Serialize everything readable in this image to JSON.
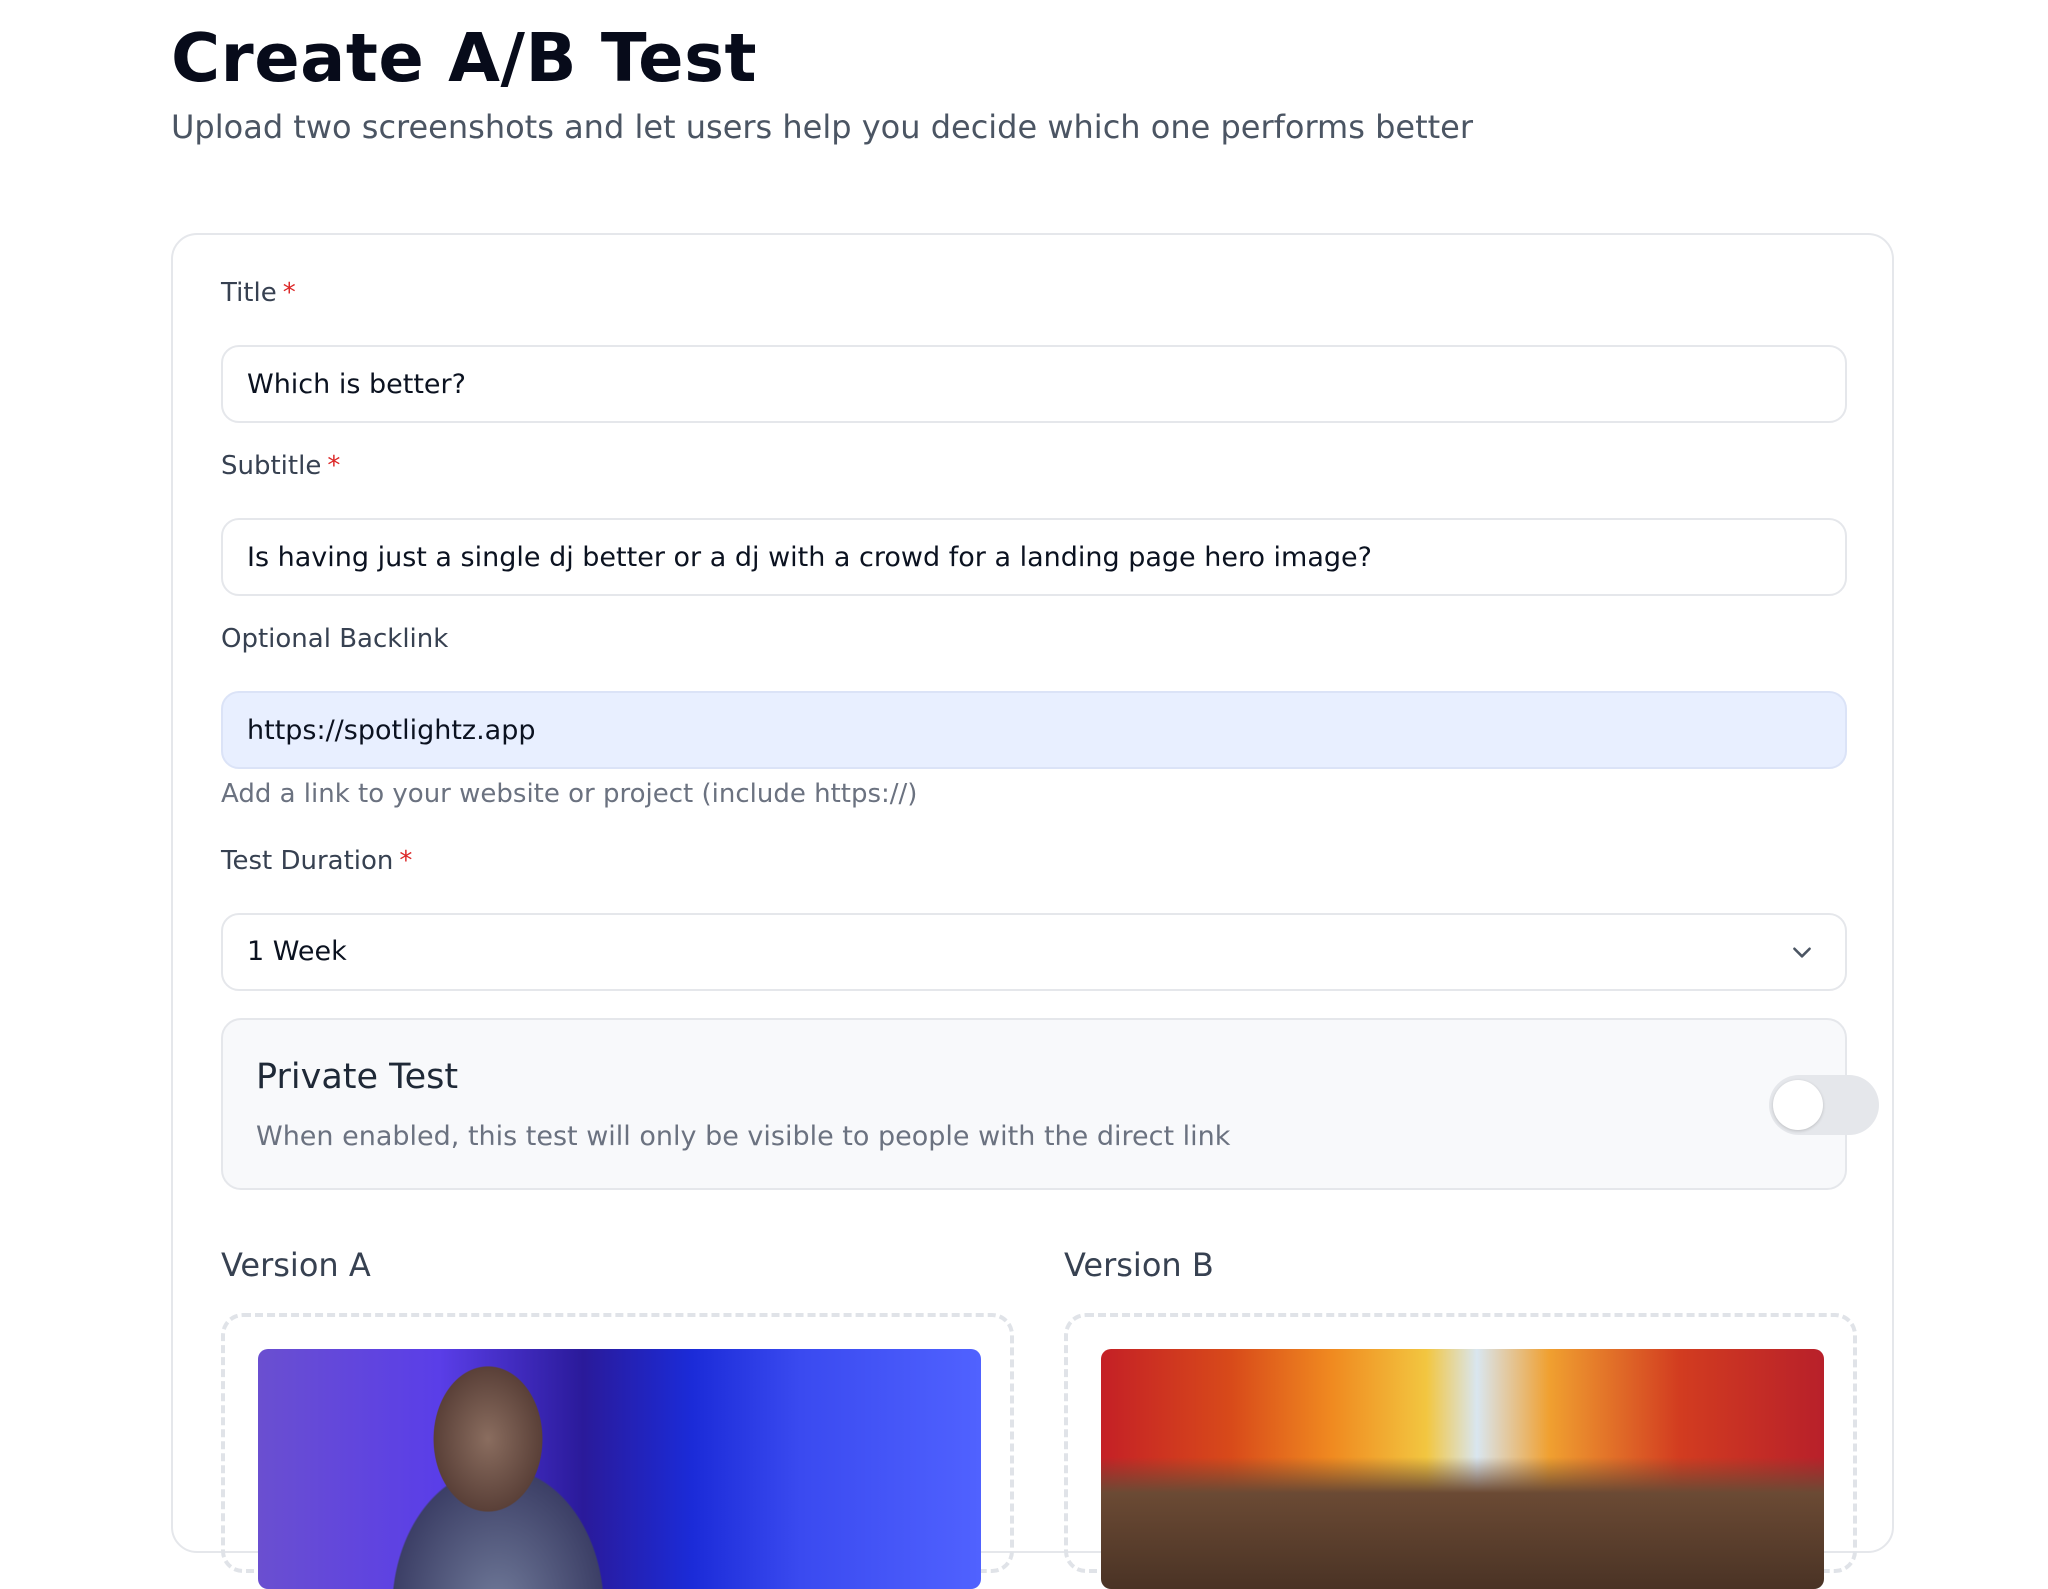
{
  "header": {
    "title": "Create A/B Test",
    "subtitle": "Upload two screenshots and let users help you decide which one performs better"
  },
  "form": {
    "title_field": {
      "label": "Title",
      "required_mark": "*",
      "value": "Which is better?"
    },
    "subtitle_field": {
      "label": "Subtitle",
      "required_mark": "*",
      "value": "Is having just a single dj better or a dj with a crowd for a landing page hero image?"
    },
    "backlink_field": {
      "label": "Optional Backlink",
      "value": "https://spotlightz.app",
      "help": "Add a link to your website or project (include https://)"
    },
    "duration_field": {
      "label": "Test Duration",
      "required_mark": "*",
      "selected": "1 Week"
    },
    "private_test": {
      "title": "Private Test",
      "description": "When enabled, this test will only be visible to people with the direct link",
      "enabled": false
    },
    "versions": [
      {
        "label": "Version A"
      },
      {
        "label": "Version B"
      }
    ]
  },
  "colors": {
    "required": "#dc2626",
    "autofill_bg": "#e8efff",
    "toggle_off": "#e5e7eb",
    "title_text": "#070b1a"
  },
  "icons": {
    "duration_select": "chevron-down-icon"
  }
}
